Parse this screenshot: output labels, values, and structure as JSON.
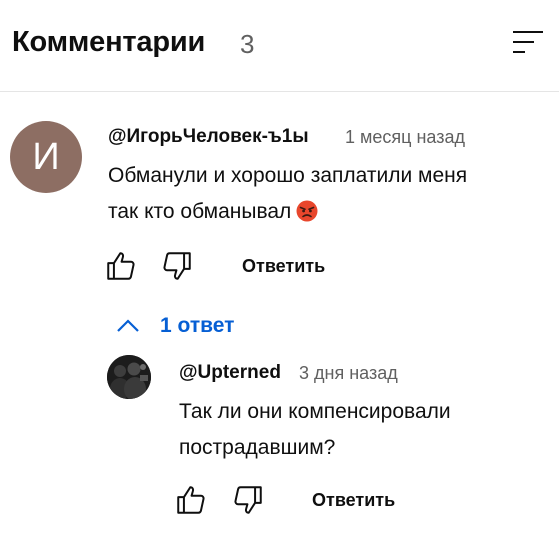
{
  "header": {
    "title": "Комментарии",
    "count": "3"
  },
  "comments": [
    {
      "avatar_letter": "И",
      "avatar_color": "#8d6e63",
      "author": "@ИгорьЧеловек-ъ1ы",
      "time": "1 месяц назад",
      "text_line1": "Обманули и хорошо заплатили меня",
      "text_line2": "так кто обманывал",
      "emoji": "angry-face-emoji",
      "reply_label": "Ответить"
    }
  ],
  "replies_toggle": {
    "label": "1 ответ",
    "icon": "chevron-up-icon",
    "color": "#065fd4"
  },
  "replies": [
    {
      "author": "@Upterned",
      "time": "3 дня назад",
      "text_line1": "Так ли они компенсировали",
      "text_line2": "пострадавшим?",
      "reply_label": "Ответить"
    }
  ]
}
